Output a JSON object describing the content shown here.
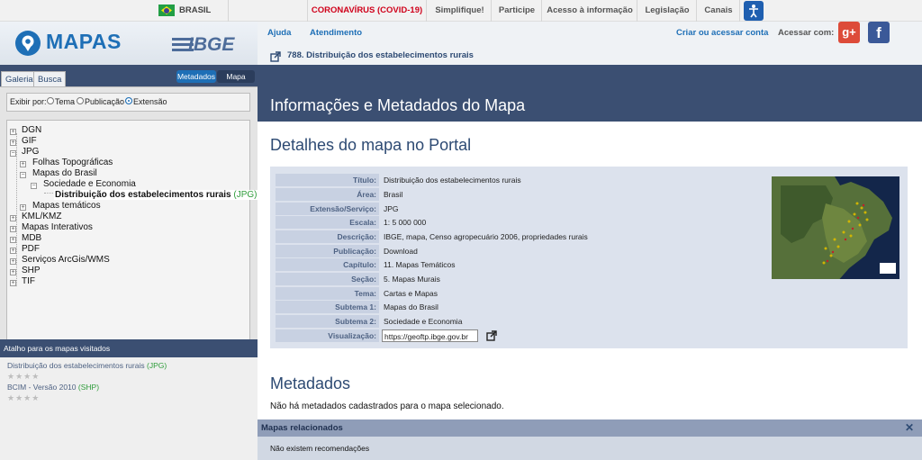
{
  "gov_bar": {
    "country": "BRASIL",
    "covid": "CORONAVÍRUS (COVID-19)",
    "links": [
      "Simplifique!",
      "Participe",
      "Acesso à informação",
      "Legislação",
      "Canais"
    ]
  },
  "brand": {
    "app": "MAPAS",
    "org": "IBGE"
  },
  "header": {
    "help": "Ajuda",
    "service": "Atendimento",
    "login": "Criar ou acessar conta",
    "access_with": "Acessar com:",
    "breadcrumb": "788. Distribuição dos estabelecimentos rurais"
  },
  "sidebar": {
    "tabs": [
      "Galeria",
      "Busca"
    ],
    "toggle": [
      "Metadados",
      "Mapa"
    ],
    "filter": {
      "label": "Exibir por:",
      "options": [
        "Tema",
        "Publicação",
        "Extensão"
      ],
      "selected": "Extensão"
    },
    "tree": [
      {
        "label": "DGN",
        "sign": "+"
      },
      {
        "label": "GIF",
        "sign": "+"
      },
      {
        "label": "JPG",
        "sign": "−"
      },
      {
        "label": "Folhas Topográficas",
        "sign": "+"
      },
      {
        "label": "Mapas do Brasil",
        "sign": "−"
      },
      {
        "label": "Sociedade e Economia",
        "sign": "−"
      },
      {
        "label": "Distribuição dos estabelecimentos rurais",
        "suffix": "(JPG)",
        "sign": ""
      },
      {
        "label": "Mapas temáticos",
        "sign": "+"
      },
      {
        "label": "KML/KMZ",
        "sign": "+"
      },
      {
        "label": "Mapas Interativos",
        "sign": "+"
      },
      {
        "label": "MDB",
        "sign": "+"
      },
      {
        "label": "PDF",
        "sign": "+"
      },
      {
        "label": "Serviços ArcGis/WMS",
        "sign": "+"
      },
      {
        "label": "SHP",
        "sign": "+"
      },
      {
        "label": "TIF",
        "sign": "+"
      }
    ],
    "shortcuts_title": "Atalho para os mapas visitados",
    "shortcuts": [
      {
        "label": "Distribuição dos estabelecimentos rurais",
        "suffix": "(JPG)",
        "rating": 0
      },
      {
        "label": "BCIM - Versão 2010",
        "suffix": "(SHP)",
        "rating": 0
      }
    ]
  },
  "main": {
    "title": "Informações e Metadados do Mapa",
    "details_title": "Detalhes do mapa no Portal",
    "rows": [
      {
        "k": "Título:",
        "v": "Distribuição dos estabelecimentos rurais"
      },
      {
        "k": "Área:",
        "v": "Brasil"
      },
      {
        "k": "Extensão/Serviço:",
        "v": "JPG"
      },
      {
        "k": "Escala:",
        "v": "1: 5 000 000"
      },
      {
        "k": "Descrição:",
        "v": "IBGE, mapa, Censo agropecuário 2006, propriedades rurais"
      },
      {
        "k": "Publicação:",
        "v": "Download"
      },
      {
        "k": "Capítulo:",
        "v": "11. Mapas Temáticos"
      },
      {
        "k": "Seção:",
        "v": "5. Mapas Murais"
      },
      {
        "k": "Tema:",
        "v": "Cartas e Mapas"
      },
      {
        "k": "Subtema 1:",
        "v": "Mapas do Brasil"
      },
      {
        "k": "Subtema 2:",
        "v": "Sociedade e Economia"
      },
      {
        "k": "Visualização:",
        "v": "https://geoftp.ibge.gov.br"
      }
    ],
    "metadata_title": "Metadados",
    "metadata_text": "Não há metadados cadastrados para o mapa selecionado."
  },
  "related": {
    "title": "Mapas relacionados",
    "close": "✕",
    "text": "Não existem recomendações"
  },
  "colors": {
    "header_navy": "#3b4f72",
    "covid_red": "#d0021b",
    "link_blue": "#1e6fb6",
    "tree_green": "#2e9c3a",
    "google_red": "#dd4b39",
    "facebook_blue": "#3b5998"
  }
}
